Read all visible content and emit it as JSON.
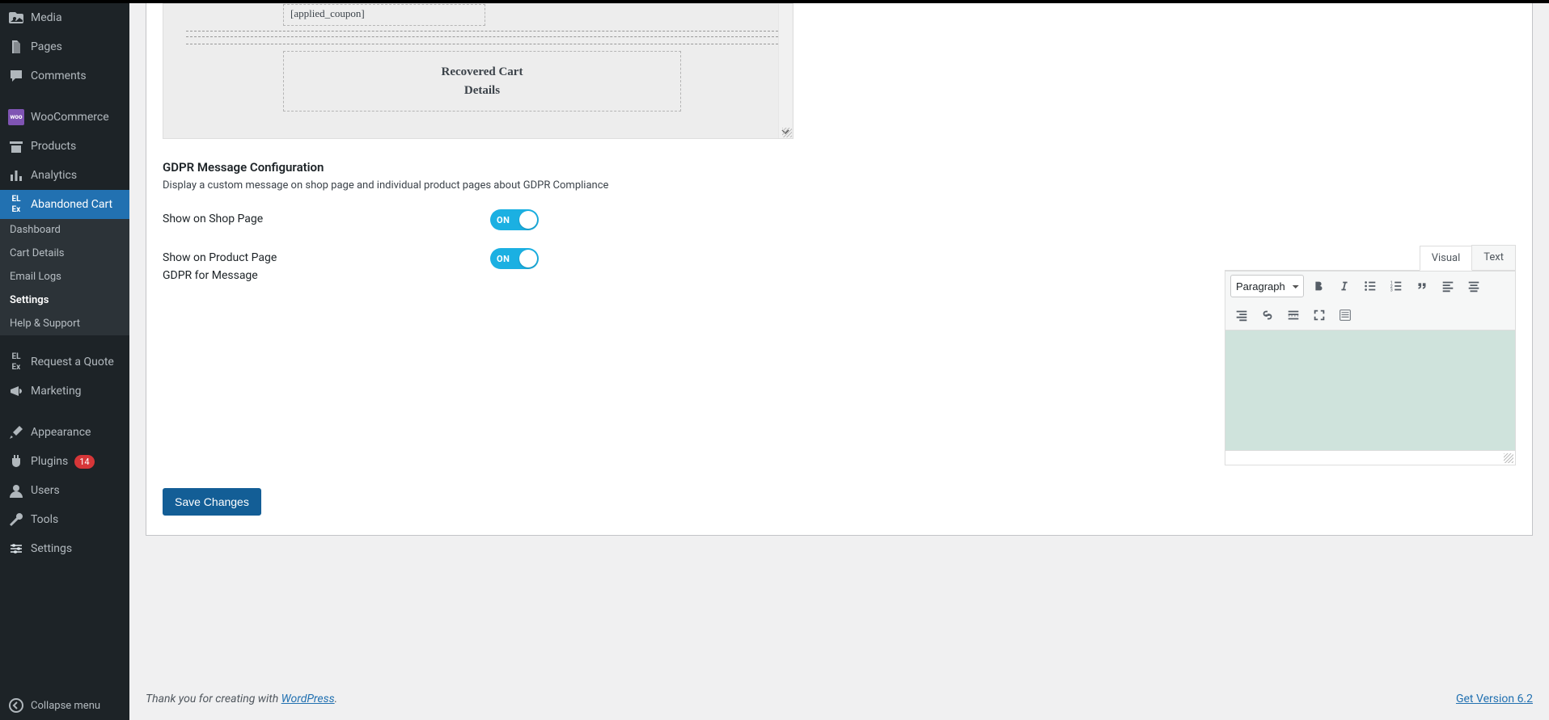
{
  "sidebar": {
    "items_top": [
      {
        "name": "media",
        "label": "Media"
      },
      {
        "name": "pages",
        "label": "Pages"
      },
      {
        "name": "comments",
        "label": "Comments"
      }
    ],
    "items_mid": [
      {
        "name": "woocommerce",
        "label": "WooCommerce"
      },
      {
        "name": "products",
        "label": "Products"
      },
      {
        "name": "analytics",
        "label": "Analytics"
      },
      {
        "name": "abandoned-cart",
        "label": "Abandoned Cart"
      }
    ],
    "sub_items": [
      {
        "name": "dashboard",
        "label": "Dashboard"
      },
      {
        "name": "cart-details",
        "label": "Cart Details"
      },
      {
        "name": "email-logs",
        "label": "Email Logs"
      },
      {
        "name": "settings",
        "label": "Settings"
      },
      {
        "name": "help-support",
        "label": "Help & Support"
      }
    ],
    "items_mid2": [
      {
        "name": "request-a-quote",
        "label": "Request a Quote"
      },
      {
        "name": "marketing",
        "label": "Marketing"
      }
    ],
    "items_bottom": [
      {
        "name": "appearance",
        "label": "Appearance"
      },
      {
        "name": "plugins",
        "label": "Plugins",
        "badge": "14"
      },
      {
        "name": "users",
        "label": "Users"
      },
      {
        "name": "tools",
        "label": "Tools"
      },
      {
        "name": "settings",
        "label": "Settings"
      }
    ],
    "collapse_label": "Collapse menu"
  },
  "template": {
    "applied_coupon_tag": "[applied_coupon]",
    "recovered_line1": "Recovered Cart",
    "recovered_line2": "Details"
  },
  "gdpr": {
    "heading": "GDPR Message Configuration",
    "desc": "Display a custom message on shop page and individual product pages about GDPR Compliance",
    "show_shop_label": "Show on Shop Page",
    "show_product_label": "Show on Product Page",
    "message_label": "GDPR for Message",
    "toggle_on": "ON"
  },
  "rte": {
    "tabs": {
      "visual": "Visual",
      "text": "Text"
    },
    "paragraph": "Paragraph"
  },
  "buttons": {
    "save": "Save Changes"
  },
  "footer": {
    "prefix": "Thank you for creating with ",
    "link": "WordPress",
    "suffix": ".",
    "version": "Get Version 6.2"
  }
}
